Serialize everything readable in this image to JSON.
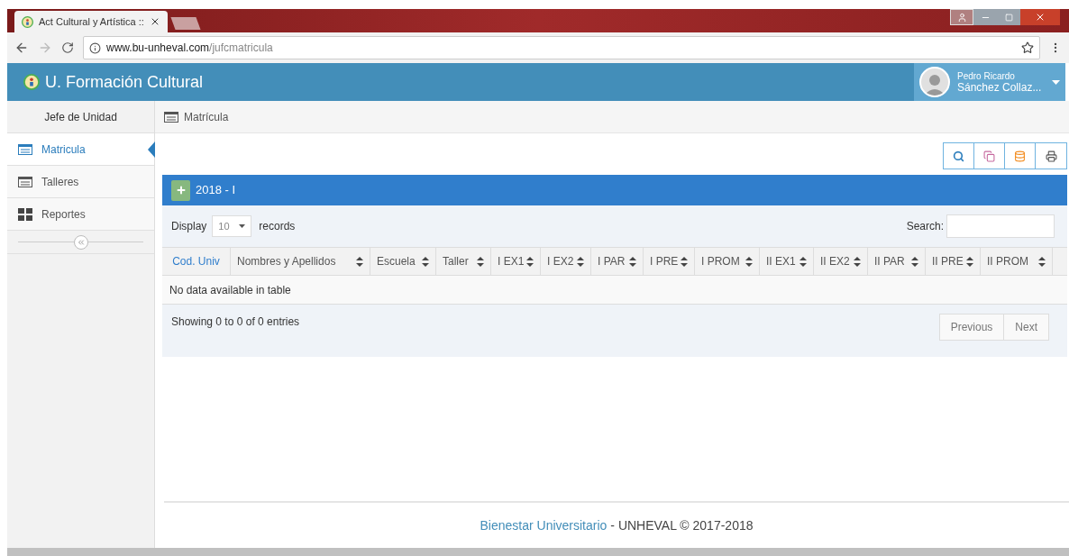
{
  "browser": {
    "tab_title": "Act Cultural y Artística ::",
    "url_host": "www.bu-unheval.com",
    "url_path": "/jufcmatricula"
  },
  "header": {
    "title": "U. Formación Cultural",
    "user_first": "Pedro Ricardo",
    "user_last": "Sánchez Collaz..."
  },
  "sidebar": {
    "role": "Jefe de Unidad",
    "items": [
      {
        "label": "Matricula",
        "kind": "list",
        "selected": true
      },
      {
        "label": "Talleres",
        "kind": "list",
        "selected": false
      },
      {
        "label": "Reportes",
        "kind": "grid",
        "selected": false
      }
    ]
  },
  "breadcrumb": "Matrícula",
  "panel": {
    "title": "2018 - I",
    "display_label": "Display",
    "page_size": "10",
    "records_label": "records",
    "search_label": "Search:",
    "columns": [
      {
        "label": "Cod. Univ",
        "sorted": true
      },
      {
        "label": "Nombres y Apellidos",
        "sorted": false
      },
      {
        "label": "Escuela",
        "sorted": false
      },
      {
        "label": "Taller",
        "sorted": false
      },
      {
        "label": "I EX1",
        "sorted": false
      },
      {
        "label": "I EX2",
        "sorted": false
      },
      {
        "label": "I PAR",
        "sorted": false
      },
      {
        "label": "I PRE",
        "sorted": false
      },
      {
        "label": "I PROM",
        "sorted": false
      },
      {
        "label": "II EX1",
        "sorted": false
      },
      {
        "label": "II EX2",
        "sorted": false
      },
      {
        "label": "II PAR",
        "sorted": false
      },
      {
        "label": "II PRE",
        "sorted": false
      },
      {
        "label": "II PROM",
        "sorted": false
      }
    ],
    "empty_message": "No data available in table",
    "info": "Showing 0 to 0 of 0 entries",
    "prev": "Previous",
    "next": "Next"
  },
  "footer": {
    "link": "Bienestar Universitario",
    "text": "- UNHEVAL © 2017-2018"
  }
}
